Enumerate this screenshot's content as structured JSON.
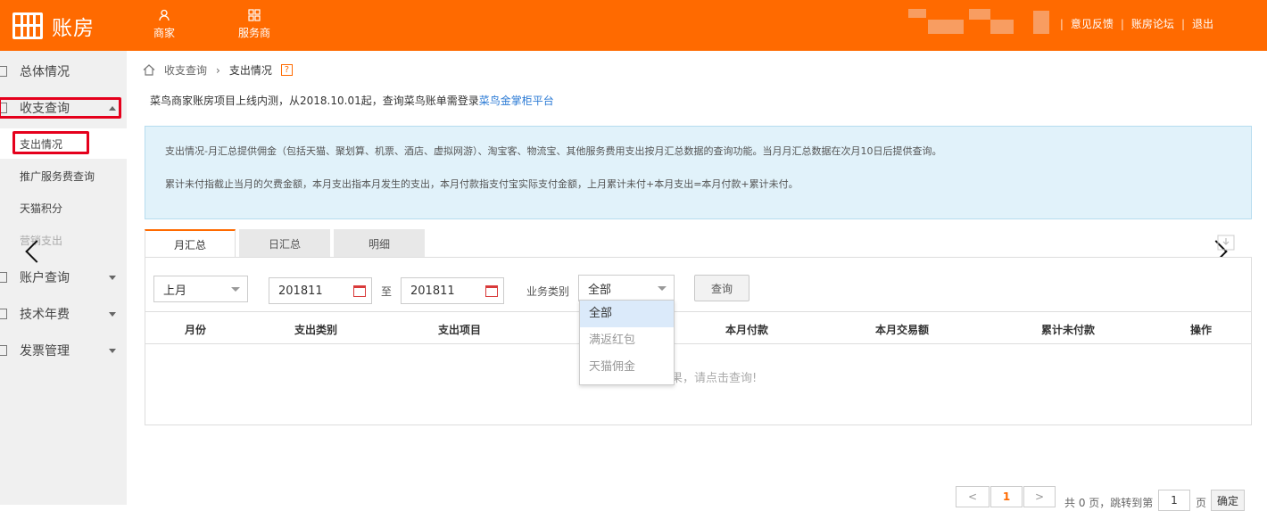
{
  "app": {
    "title": "账房"
  },
  "topnav": [
    {
      "label": "商家",
      "icon": "user-icon"
    },
    {
      "label": "服务商",
      "icon": "grid-icon"
    }
  ],
  "toplinks": {
    "sep": "|",
    "feedback": "意见反馈",
    "forum": "账房论坛",
    "logout": "退出"
  },
  "sidebar": {
    "items": [
      {
        "label": "总体情况",
        "icon": "doc-icon"
      },
      {
        "label": "收支查询",
        "icon": "doc-icon",
        "expanded": true
      },
      {
        "label": "账户查询",
        "icon": "doc-icon"
      },
      {
        "label": "技术年费",
        "icon": "doc-icon"
      },
      {
        "label": "发票管理",
        "icon": "doc-icon"
      }
    ],
    "subitems": [
      "支出情况",
      "推广服务费查询",
      "天猫积分",
      "营销支出"
    ]
  },
  "breadcrumb": {
    "parent": "收支查询",
    "current": "支出情况",
    "help": "?"
  },
  "notice": {
    "text": "菜鸟商家账房项目上线内测，从2018.10.01起，查询菜鸟账单需登录",
    "link": "菜鸟金掌柜平台"
  },
  "info": {
    "line1": "支出情况-月汇总提供佣金（包括天猫、聚划算、机票、酒店、虚拟网游）、淘宝客、物流宝、其他服务费用支出按月汇总数据的查询功能。当月月汇总数据在次月10日后提供查询。",
    "line2": "累计未付指截止当月的欠费金额，本月支出指本月发生的支出，本月付款指支付宝实际支付金额，上月累计未付+本月支出=本月付款+累计未付。"
  },
  "tabs": [
    "月汇总",
    "日汇总",
    "明细"
  ],
  "filters": {
    "period": "上月",
    "start": "201811",
    "to": "至",
    "end": "201811",
    "type_label": "业务类别",
    "type_value": "全部",
    "query": "查询"
  },
  "dropdown": {
    "options": [
      "全部",
      "满返红包",
      "天猫佣金"
    ],
    "selected": "全部"
  },
  "table": {
    "columns": [
      "月份",
      "支出类别",
      "支出项目",
      "本月付款",
      "本月交易额",
      "累计未付款",
      "操作"
    ],
    "empty": "果，请点击查询!"
  },
  "pager": {
    "prev": "<",
    "page": "1",
    "next": ">",
    "total": "共 0 页，跳转到第",
    "goto": "1",
    "unit": "页",
    "confirm": "确定"
  },
  "colors": {
    "brand": "#ff6a00",
    "highlight": "#e5001c",
    "link": "#2c7bd5"
  }
}
